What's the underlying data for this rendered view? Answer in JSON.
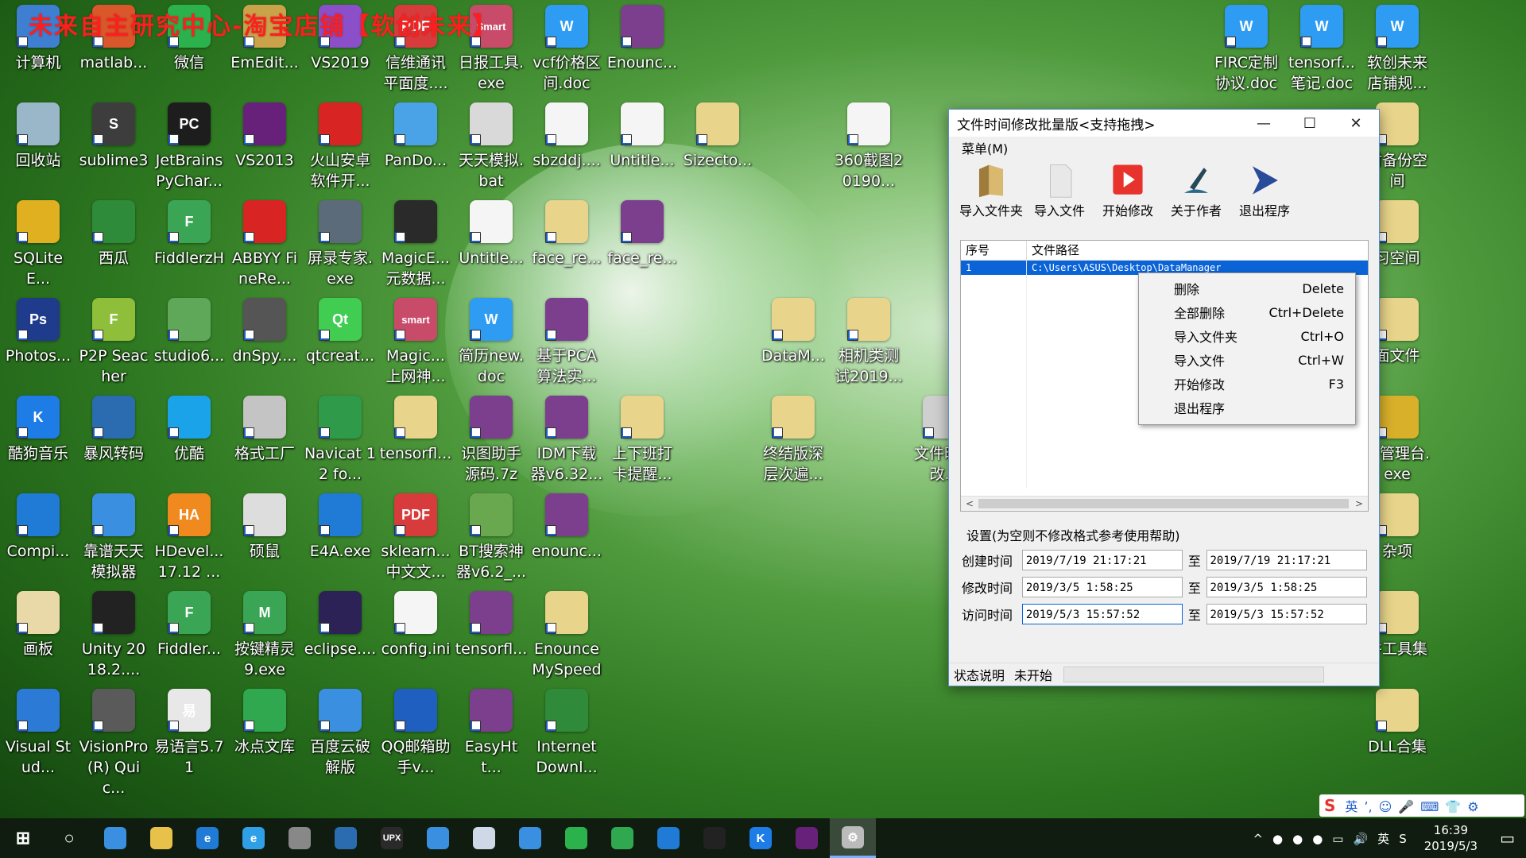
{
  "watermark": "未来自主研究中心-淘宝店铺【软创未来】",
  "desktop_icons": [
    {
      "label": "计算机",
      "glyph": "",
      "color": "#3f7fd1",
      "icon": "computer-icon"
    },
    {
      "label": "matlab...",
      "glyph": "",
      "color": "#d9572a",
      "icon": "matlab-icon"
    },
    {
      "label": "微信",
      "glyph": "",
      "color": "#2bb24c",
      "icon": "wechat-icon"
    },
    {
      "label": "EmEdit...",
      "glyph": "",
      "color": "#c9a24a",
      "icon": "emeditor-icon"
    },
    {
      "label": "VS2019",
      "glyph": "",
      "color": "#8a4fc9",
      "icon": "visual-studio-icon"
    },
    {
      "label": "信维通讯平面度....",
      "glyph": "PDF",
      "color": "#d83b3b",
      "icon": "pdf-icon"
    },
    {
      "label": "日报工具.exe",
      "glyph": "Smart",
      "color": "#c94b6a",
      "icon": "smart-icon"
    },
    {
      "label": "vcf价格区间.doc",
      "glyph": "W",
      "color": "#2d9cf2",
      "icon": "wps-doc-icon"
    },
    {
      "label": "Enounc...",
      "glyph": "",
      "color": "#7b3f8e",
      "icon": "winrar-icon"
    },
    {
      "label": "FIRC定制协议.doc",
      "glyph": "W",
      "color": "#2d9cf2",
      "icon": "wps-doc-icon"
    },
    {
      "label": "tensorf...笔记.doc",
      "glyph": "W",
      "color": "#2d9cf2",
      "icon": "wps-doc-icon"
    },
    {
      "label": "软创未来店铺规...",
      "glyph": "W",
      "color": "#2d9cf2",
      "icon": "wps-doc-icon"
    },
    {
      "label": "回收站",
      "glyph": "",
      "color": "#9ab7c9",
      "icon": "recycle-bin-icon"
    },
    {
      "label": "sublime3",
      "glyph": "S",
      "color": "#3d3d3d",
      "icon": "sublime-icon"
    },
    {
      "label": "JetBrains PyChar...",
      "glyph": "PC",
      "color": "#1d1d1d",
      "icon": "pycharm-icon"
    },
    {
      "label": "VS2013",
      "glyph": "",
      "color": "#68217a",
      "icon": "visual-studio-icon"
    },
    {
      "label": "火山安卓软件开...",
      "glyph": "",
      "color": "#d92424",
      "icon": "volcano-icon"
    },
    {
      "label": "PanDo...",
      "glyph": "",
      "color": "#4aa3e6",
      "icon": "pandownload-icon"
    },
    {
      "label": "天天模拟.bat",
      "glyph": "",
      "color": "#d9d9d9",
      "icon": "bat-file-icon"
    },
    {
      "label": "sbzddj....",
      "glyph": "",
      "color": "#f5f5f5",
      "icon": "file-icon"
    },
    {
      "label": "Untitle...",
      "glyph": "",
      "color": "#f5f5f5",
      "icon": "file-icon"
    },
    {
      "label": "Sizecto...",
      "glyph": "",
      "color": "#e8d48a",
      "icon": "folder-icon"
    },
    {
      "label": "360截图20190...",
      "glyph": "",
      "color": "#f5f5f5",
      "icon": "image-file-icon"
    },
    {
      "label": "时备份空间",
      "glyph": "",
      "color": "#e8d48a",
      "icon": "folder-icon"
    },
    {
      "label": "SQLiteE...",
      "glyph": "",
      "color": "#e0b020",
      "icon": "sqlite-icon"
    },
    {
      "label": "西瓜",
      "glyph": "",
      "color": "#2e8b3a",
      "icon": "watermelon-icon"
    },
    {
      "label": "FiddlerzH",
      "glyph": "F",
      "color": "#3aa655",
      "icon": "fiddler-icon"
    },
    {
      "label": "ABBYY FineRe...",
      "glyph": "",
      "color": "#d92424",
      "icon": "abbyy-icon"
    },
    {
      "label": "屏录专家.exe",
      "glyph": "",
      "color": "#5c6b7a",
      "icon": "screen-recorder-icon"
    },
    {
      "label": "MagicE...元数据...",
      "glyph": "",
      "color": "#2a2a2a",
      "icon": "magic-icon"
    },
    {
      "label": "Untitle...",
      "glyph": "",
      "color": "#f5f5f5",
      "icon": "file-icon"
    },
    {
      "label": "face_re...",
      "glyph": "",
      "color": "#e8d48a",
      "icon": "folder-icon"
    },
    {
      "label": "face_re...",
      "glyph": "",
      "color": "#7b3f8e",
      "icon": "winrar-icon"
    },
    {
      "label": "习空间",
      "glyph": "",
      "color": "#e8d48a",
      "icon": "folder-icon"
    },
    {
      "label": "Photos...",
      "glyph": "Ps",
      "color": "#1f3b8c",
      "icon": "photoshop-icon"
    },
    {
      "label": "P2P Seacher",
      "glyph": "F",
      "color": "#8fbf3a",
      "icon": "p2p-icon"
    },
    {
      "label": "studio6...",
      "glyph": "",
      "color": "#5fa85a",
      "icon": "android-studio-icon"
    },
    {
      "label": "dnSpy....",
      "glyph": "",
      "color": "#555555",
      "icon": "dnspy-icon"
    },
    {
      "label": "qtcreat...",
      "glyph": "Qt",
      "color": "#41cd52",
      "icon": "qt-icon"
    },
    {
      "label": "Magic...上网神...",
      "glyph": "smart",
      "color": "#c94b6a",
      "icon": "smart-icon"
    },
    {
      "label": "简历new.doc",
      "glyph": "W",
      "color": "#2d9cf2",
      "icon": "wps-doc-icon"
    },
    {
      "label": "基于PCA算法实...",
      "glyph": "",
      "color": "#7b3f8e",
      "icon": "winrar-icon"
    },
    {
      "label": "DataM...",
      "glyph": "",
      "color": "#e8d48a",
      "icon": "vs-project-icon"
    },
    {
      "label": "相机类测试2019...",
      "glyph": "",
      "color": "#e8d48a",
      "icon": "vs-project-icon"
    },
    {
      "label": "面文件",
      "glyph": "",
      "color": "#e8d48a",
      "icon": "folder-icon"
    },
    {
      "label": "酷狗音乐",
      "glyph": "K",
      "color": "#1e7ce6",
      "icon": "kugou-icon"
    },
    {
      "label": "暴风转码",
      "glyph": "",
      "color": "#2b6cb0",
      "icon": "storm-icon"
    },
    {
      "label": "优酷",
      "glyph": "",
      "color": "#1aa3e8",
      "icon": "youku-icon"
    },
    {
      "label": "格式工厂",
      "glyph": "",
      "color": "#c4c4c4",
      "icon": "format-factory-icon"
    },
    {
      "label": "Navicat 12 fo...",
      "glyph": "",
      "color": "#2f9a4a",
      "icon": "navicat-icon"
    },
    {
      "label": "tensorfl...",
      "glyph": "",
      "color": "#e8d48a",
      "icon": "folder-icon"
    },
    {
      "label": "识图助手源码.7z",
      "glyph": "",
      "color": "#7b3f8e",
      "icon": "winrar-icon"
    },
    {
      "label": "IDM下载器v6.32...",
      "glyph": "",
      "color": "#7b3f8e",
      "icon": "winrar-icon"
    },
    {
      "label": "上下班打卡提醒...",
      "glyph": "",
      "color": "#e8d48a",
      "icon": "vs-project-icon"
    },
    {
      "label": "终结版深层次遍...",
      "glyph": "",
      "color": "#e8d48a",
      "icon": "vs-project-icon"
    },
    {
      "label": "文件时修改...",
      "glyph": "",
      "color": "#cfcfcf",
      "icon": "gear-icon"
    },
    {
      "label": "件管理台.exe",
      "glyph": "",
      "color": "#d9b02a",
      "icon": "app-icon"
    },
    {
      "label": "Compi...",
      "glyph": "",
      "color": "#1f7bd6",
      "icon": "compiler-icon"
    },
    {
      "label": "靠谱天天模拟器",
      "glyph": "",
      "color": "#3a8fe0",
      "icon": "emulator-icon"
    },
    {
      "label": "HDevel...17.12 ...",
      "glyph": "HA",
      "color": "#f08a1f",
      "icon": "halcon-icon"
    },
    {
      "label": "硕鼠",
      "glyph": "",
      "color": "#dddddd",
      "icon": "mouse-icon"
    },
    {
      "label": "E4A.exe",
      "glyph": "",
      "color": "#1f7bd6",
      "icon": "e4a-icon"
    },
    {
      "label": "sklearn...中文文...",
      "glyph": "PDF",
      "color": "#d83b3b",
      "icon": "pdf-icon"
    },
    {
      "label": "BT搜索神器v6.2_...",
      "glyph": "",
      "color": "#6aa84f",
      "icon": "bt-icon"
    },
    {
      "label": "enounc...",
      "glyph": "",
      "color": "#7b3f8e",
      "icon": "winrar-icon"
    },
    {
      "label": "杂项",
      "glyph": "",
      "color": "#e8d48a",
      "icon": "folder-icon"
    },
    {
      "label": "画板",
      "glyph": "",
      "color": "#e9d9a9",
      "icon": "paint-icon"
    },
    {
      "label": "Unity 2018.2....",
      "glyph": "",
      "color": "#222222",
      "icon": "unity-icon"
    },
    {
      "label": "Fiddler...",
      "glyph": "F",
      "color": "#3aa655",
      "icon": "fiddler-icon"
    },
    {
      "label": "按键精灵9.exe",
      "glyph": "M",
      "color": "#3aa655",
      "icon": "keyboard-wizard-icon"
    },
    {
      "label": "eclipse....",
      "glyph": "",
      "color": "#2c2255",
      "icon": "eclipse-icon"
    },
    {
      "label": "config.ini",
      "glyph": "",
      "color": "#f5f5f5",
      "icon": "config-file-icon"
    },
    {
      "label": "tensorfl...",
      "glyph": "",
      "color": "#7b3f8e",
      "icon": "winrar-icon"
    },
    {
      "label": "Enounce MySpeed",
      "glyph": "",
      "color": "#e8d48a",
      "icon": "folder-icon"
    },
    {
      "label": "件工具集",
      "glyph": "",
      "color": "#e8d48a",
      "icon": "folder-icon"
    },
    {
      "label": "Visual Stud...",
      "glyph": "",
      "color": "#2b7bd6",
      "icon": "vscode-icon"
    },
    {
      "label": "VisionPro (R) Quic...",
      "glyph": "",
      "color": "#5a5a5a",
      "icon": "visionpro-icon"
    },
    {
      "label": "易语言5.71",
      "glyph": "易",
      "color": "#e8e8e8",
      "icon": "eyuyan-icon"
    },
    {
      "label": "冰点文库",
      "glyph": "",
      "color": "#2fa84f",
      "icon": "wenku-icon"
    },
    {
      "label": "百度云破解版",
      "glyph": "",
      "color": "#3a8fe0",
      "icon": "baidu-cloud-icon"
    },
    {
      "label": "QQ邮箱助手v...",
      "glyph": "",
      "color": "#1f5fbf",
      "icon": "qqmail-icon"
    },
    {
      "label": "EasyHtt...",
      "glyph": "",
      "color": "#7b3f8e",
      "icon": "winrar-icon"
    },
    {
      "label": "Internet Downl...",
      "glyph": "",
      "color": "#2f8a3a",
      "icon": "idm-icon"
    },
    {
      "label": "DLL合集",
      "glyph": "",
      "color": "#e8d48a",
      "icon": "folder-icon"
    }
  ],
  "window": {
    "title": "文件时间修改批量版<支持拖拽>",
    "minimize": "—",
    "maximize": "☐",
    "close": "✕",
    "menu": "菜单(M)",
    "toolbar": [
      {
        "label": "导入文件夹",
        "icon": "folder-import-icon"
      },
      {
        "label": "导入文件",
        "icon": "file-import-icon"
      },
      {
        "label": "开始修改",
        "icon": "play-icon"
      },
      {
        "label": "关于作者",
        "icon": "pen-icon"
      },
      {
        "label": "退出程序",
        "icon": "exit-arrow-icon"
      }
    ],
    "list": {
      "col_index": "序号",
      "col_path": "文件路径",
      "rows": [
        {
          "index": "1",
          "path": "C:\\Users\\ASUS\\Desktop\\DataManager"
        }
      ],
      "scroll_left": "<",
      "scroll_right": ">"
    },
    "settings_title": "设置(为空则不修改格式参考使用帮助)",
    "times": [
      {
        "label": "创建时间",
        "from": "2019/7/19 21:17:21",
        "to_label": "至",
        "to": "2019/7/19 21:17:21"
      },
      {
        "label": "修改时间",
        "from": "2019/3/5 1:58:25",
        "to_label": "至",
        "to": "2019/3/5 1:58:25"
      },
      {
        "label": "访问时间",
        "from": "2019/5/3 15:57:52",
        "to_label": "至",
        "to": "2019/5/3 15:57:52"
      }
    ],
    "status_label": "状态说明",
    "status_value": "未开始"
  },
  "context_menu": [
    {
      "label": "删除",
      "shortcut": "Delete"
    },
    {
      "label": "全部删除",
      "shortcut": "Ctrl+Delete"
    },
    {
      "label": "导入文件夹",
      "shortcut": "Ctrl+O"
    },
    {
      "label": "导入文件",
      "shortcut": "Ctrl+W"
    },
    {
      "label": "开始修改",
      "shortcut": "F3"
    },
    {
      "label": "退出程序",
      "shortcut": ""
    }
  ],
  "ime_bar": [
    "英",
    "ʼ,",
    "☺",
    "🎤",
    "⌨",
    "👕",
    "⚙"
  ],
  "taskbar": {
    "items": [
      {
        "icon": "windows-start-icon",
        "glyph": "⊞",
        "color": "#101c10"
      },
      {
        "icon": "cortana-search-icon",
        "glyph": "○",
        "color": "#101c10"
      },
      {
        "icon": "browser-icon",
        "glyph": "",
        "color": "#3a8fe0"
      },
      {
        "icon": "file-explorer-icon",
        "glyph": "",
        "color": "#e8c14a"
      },
      {
        "icon": "edge-icon",
        "glyph": "e",
        "color": "#1f7bd6"
      },
      {
        "icon": "ie-icon",
        "glyph": "e",
        "color": "#2fa0e8"
      },
      {
        "icon": "camera-app-icon",
        "glyph": "",
        "color": "#888888"
      },
      {
        "icon": "storm-player-icon",
        "glyph": "",
        "color": "#2b6cb0"
      },
      {
        "icon": "upx-icon",
        "glyph": "UPX",
        "color": "#2a2a2a"
      },
      {
        "icon": "baidu-netdisk-icon",
        "glyph": "",
        "color": "#3a8fe0"
      },
      {
        "icon": "notepad-icon",
        "glyph": "",
        "color": "#cfd8e6"
      },
      {
        "icon": "feishu-icon",
        "glyph": "",
        "color": "#3a8fe0"
      },
      {
        "icon": "wechat-icon",
        "glyph": "",
        "color": "#2bb24c"
      },
      {
        "icon": "360-browser-icon",
        "glyph": "",
        "color": "#2fa84f"
      },
      {
        "icon": "tile-app-icon",
        "glyph": "",
        "color": "#1f7bd6"
      },
      {
        "icon": "qq-icon",
        "glyph": "",
        "color": "#222222"
      },
      {
        "icon": "kugou-icon",
        "glyph": "K",
        "color": "#1e7ce6"
      },
      {
        "icon": "visual-studio-icon",
        "glyph": "",
        "color": "#68217a"
      },
      {
        "icon": "gear-app-icon",
        "glyph": "⚙",
        "color": "#bbbbbb"
      }
    ],
    "tray": [
      "^",
      "●",
      "●",
      "●",
      "▭",
      "🔊",
      "英",
      "S"
    ],
    "time": "16:39",
    "date": "2019/5/3",
    "notification": "▭"
  }
}
